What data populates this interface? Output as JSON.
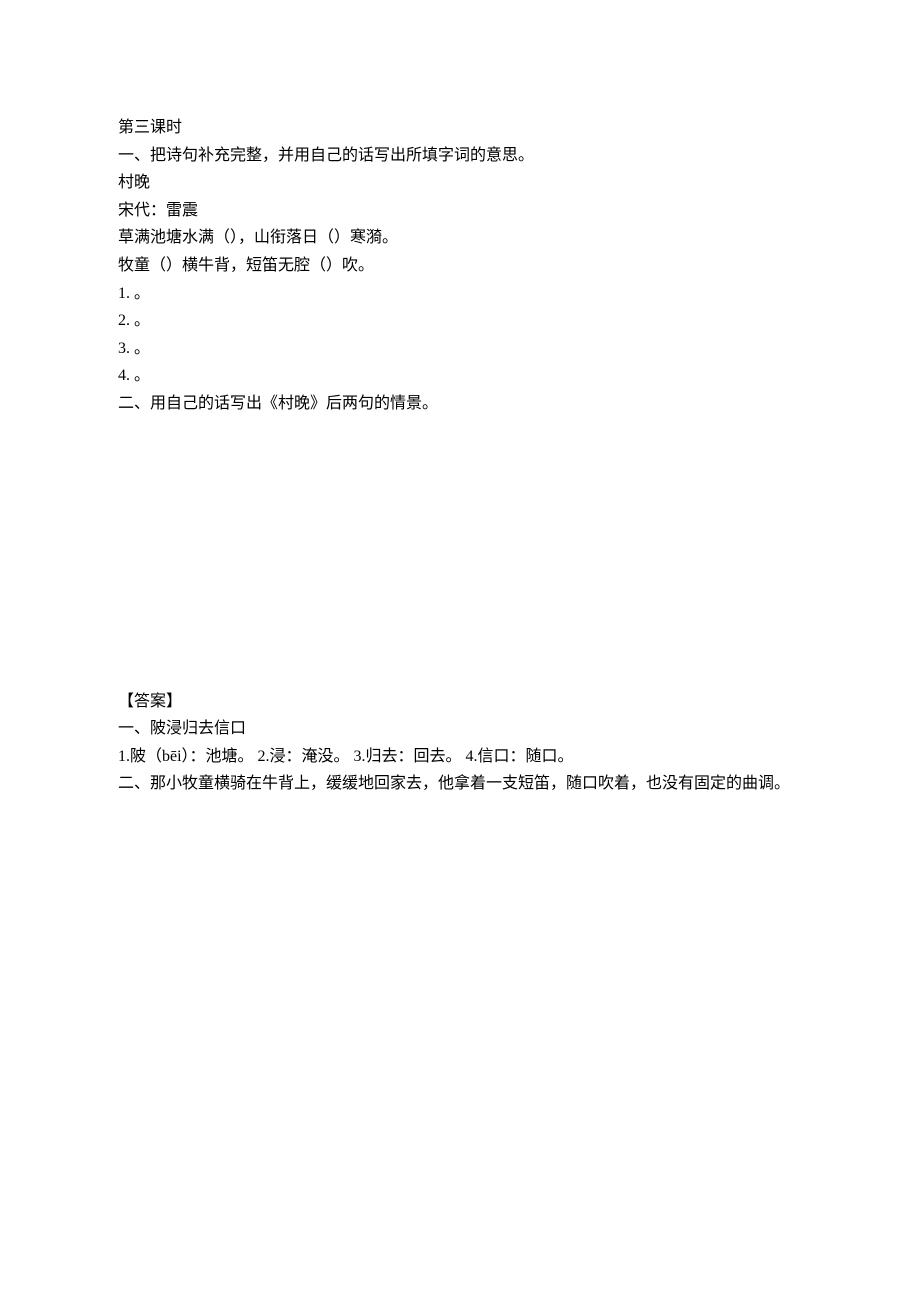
{
  "section_title": "第三课时",
  "q1_intro": "一、把诗句补充完整，并用自己的话写出所填字词的意思。",
  "poem_title": "村晚",
  "poem_author": "宋代：雷震",
  "poem_line1": "草满池塘水满（），山衔落日（）寒漪。",
  "poem_line2": "牧童（）横牛背，短笛无腔（）吹。",
  "q1_items": {
    "i1": "1.   。",
    "i2": "2.   。",
    "i3": "3.   。",
    "i4": "4.   。"
  },
  "q2_intro": "二、用自己的话写出《村晚》后两句的情景。",
  "answer_label": "【答案】",
  "answer_q1_main": "一、陂浸归去信口",
  "answer_q1_detail": "1.陂（bēi）：池塘。   2.浸：淹没。   3.归去：回去。   4.信口：随口。",
  "answer_q2": "二、那小牧童横骑在牛背上，缓缓地回家去，他拿着一支短笛，随口吹着，也没有固定的曲调。"
}
